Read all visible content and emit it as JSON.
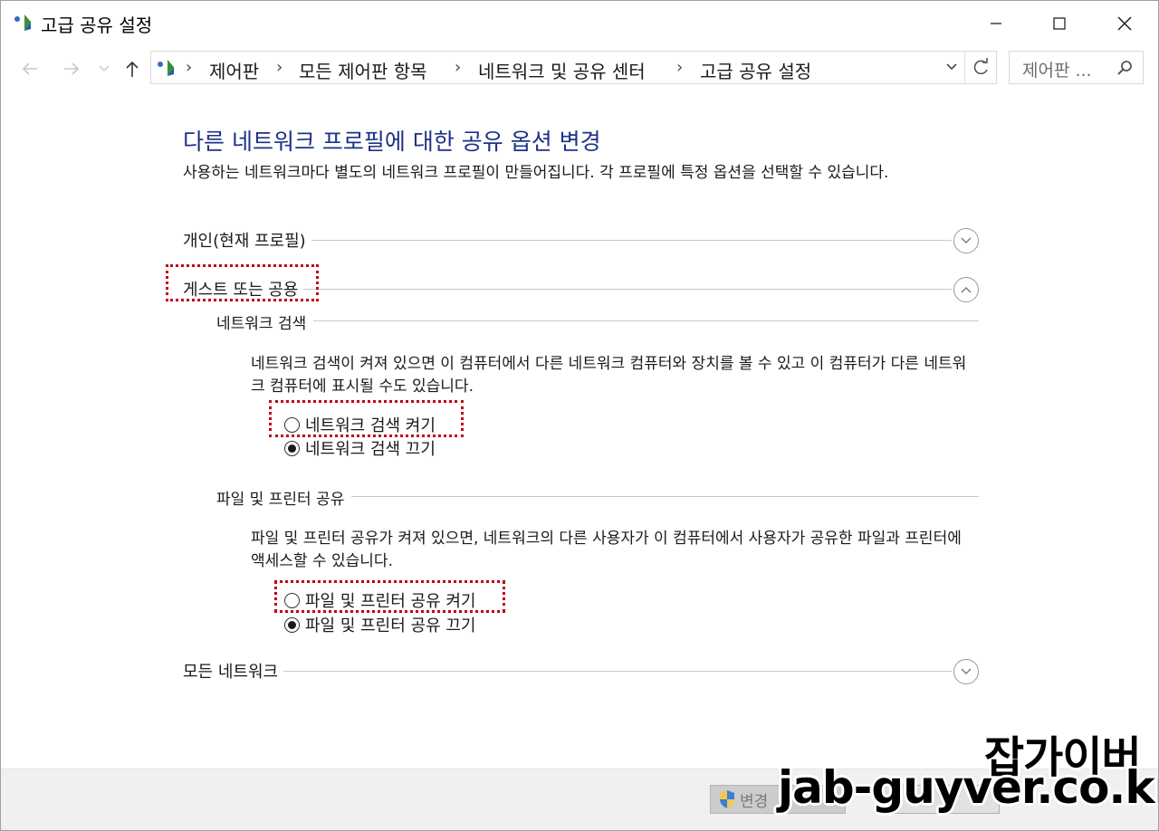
{
  "window": {
    "title": "고급 공유 설정"
  },
  "breadcrumb": {
    "items": [
      "제어판",
      "모든 제어판 항목",
      "네트워크 및 공유 센터",
      "고급 공유 설정"
    ],
    "separator": "›"
  },
  "search": {
    "placeholder": "제어판 ..."
  },
  "main": {
    "heading": "다른 네트워크 프로필에 대한 공유 옵션 변경",
    "description": "사용하는 네트워크마다 별도의 네트워크 프로필이 만들어집니다. 각 프로필에 특정 옵션을 선택할 수 있습니다.",
    "profiles": {
      "private": {
        "label": "개인(현재 프로필)",
        "expanded": false
      },
      "guest": {
        "label": "게스트 또는 공용",
        "expanded": true
      },
      "all": {
        "label": "모든 네트워크",
        "expanded": false
      }
    },
    "network_discovery": {
      "title": "네트워크 검색",
      "text": "네트워크 검색이 켜져 있으면 이 컴퓨터에서 다른 네트워크 컴퓨터와 장치를 볼 수 있고 이 컴퓨터가 다른 네트워크 컴퓨터에 표시될 수도 있습니다.",
      "on_label": "네트워크 검색 켜기",
      "off_label": "네트워크 검색 끄기",
      "selected": "off"
    },
    "file_printer_sharing": {
      "title": "파일 및 프린터 공유",
      "text": "파일 및 프린터 공유가 켜져 있으면, 네트워크의 다른 사용자가 이 컴퓨터에서 사용자가 공유한 파일과 프린터에 액세스할 수 있습니다.",
      "on_label": "파일 및 프린터 공유 켜기",
      "off_label": "파일 및 프린터 공유 끄기",
      "selected": "off"
    }
  },
  "footer": {
    "save_label": "변경"
  },
  "watermark": {
    "line1": "잡가이버",
    "line2": "jab-guyver.co.kr"
  },
  "colors": {
    "heading": "#1e3287",
    "highlight": "#c0000f"
  }
}
